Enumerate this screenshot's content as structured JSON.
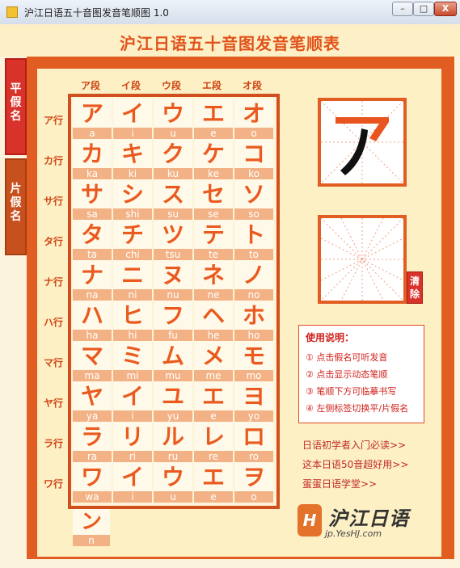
{
  "window": {
    "title": "沪江日语五十音图发音笔顺图 1.0",
    "min": "–",
    "max": "□",
    "close": "X"
  },
  "header": {
    "title": "沪江日语五十音图发音笔顺表"
  },
  "tabs": [
    {
      "label": [
        "平",
        "假",
        "名"
      ]
    },
    {
      "label": [
        "片",
        "假",
        "名"
      ]
    }
  ],
  "columns": [
    "ア段",
    "イ段",
    "ウ段",
    "エ段",
    "オ段"
  ],
  "rows": [
    {
      "label": "ア行",
      "cells": [
        [
          "ア",
          "a"
        ],
        [
          "イ",
          "i"
        ],
        [
          "ウ",
          "u"
        ],
        [
          "エ",
          "e"
        ],
        [
          "オ",
          "o"
        ]
      ]
    },
    {
      "label": "カ行",
      "cells": [
        [
          "カ",
          "ka"
        ],
        [
          "キ",
          "ki"
        ],
        [
          "ク",
          "ku"
        ],
        [
          "ケ",
          "ke"
        ],
        [
          "コ",
          "ko"
        ]
      ]
    },
    {
      "label": "サ行",
      "cells": [
        [
          "サ",
          "sa"
        ],
        [
          "シ",
          "shi"
        ],
        [
          "ス",
          "su"
        ],
        [
          "セ",
          "se"
        ],
        [
          "ソ",
          "so"
        ]
      ]
    },
    {
      "label": "タ行",
      "cells": [
        [
          "タ",
          "ta"
        ],
        [
          "チ",
          "chi"
        ],
        [
          "ツ",
          "tsu"
        ],
        [
          "テ",
          "te"
        ],
        [
          "ト",
          "to"
        ]
      ]
    },
    {
      "label": "ナ行",
      "cells": [
        [
          "ナ",
          "na"
        ],
        [
          "ニ",
          "ni"
        ],
        [
          "ヌ",
          "nu"
        ],
        [
          "ネ",
          "ne"
        ],
        [
          "ノ",
          "no"
        ]
      ]
    },
    {
      "label": "ハ行",
      "cells": [
        [
          "ハ",
          "ha"
        ],
        [
          "ヒ",
          "hi"
        ],
        [
          "フ",
          "fu"
        ],
        [
          "ヘ",
          "he"
        ],
        [
          "ホ",
          "ho"
        ]
      ]
    },
    {
      "label": "マ行",
      "cells": [
        [
          "マ",
          "ma"
        ],
        [
          "ミ",
          "mi"
        ],
        [
          "ム",
          "mu"
        ],
        [
          "メ",
          "me"
        ],
        [
          "モ",
          "mo"
        ]
      ]
    },
    {
      "label": "ヤ行",
      "cells": [
        [
          "ヤ",
          "ya"
        ],
        [
          "イ",
          "i"
        ],
        [
          "ユ",
          "yu"
        ],
        [
          "エ",
          "e"
        ],
        [
          "ヨ",
          "yo"
        ]
      ]
    },
    {
      "label": "ラ行",
      "cells": [
        [
          "ラ",
          "ra"
        ],
        [
          "リ",
          "ri"
        ],
        [
          "ル",
          "ru"
        ],
        [
          "レ",
          "re"
        ],
        [
          "ロ",
          "ro"
        ]
      ]
    },
    {
      "label": "ワ行",
      "cells": [
        [
          "ワ",
          "wa"
        ],
        [
          "イ",
          "i"
        ],
        [
          "ウ",
          "u"
        ],
        [
          "エ",
          "e"
        ],
        [
          "ヲ",
          "o"
        ]
      ]
    }
  ],
  "n_cell": {
    "kana": "ン",
    "romaji": "n"
  },
  "demo": {
    "kana": "ア"
  },
  "clear_button": [
    "清",
    "除"
  ],
  "instructions": {
    "title": "使用说明：",
    "items": [
      "① 点击假名可听发音",
      "② 点击显示动态笔顺",
      "③ 笔顺下方可临摹书写",
      "④ 左侧标签切换平/片假名"
    ]
  },
  "links": [
    "日语初学者入门必读>>",
    "这本日语50音超好用>>",
    "蛋蛋日语学堂>>"
  ],
  "logo": {
    "mark": "H",
    "text": "沪江日语",
    "url": "jp.YesHJ.com"
  },
  "colors": {
    "accent": "#e15d22",
    "kana": "#ea5a1f",
    "link": "#c0292a"
  }
}
